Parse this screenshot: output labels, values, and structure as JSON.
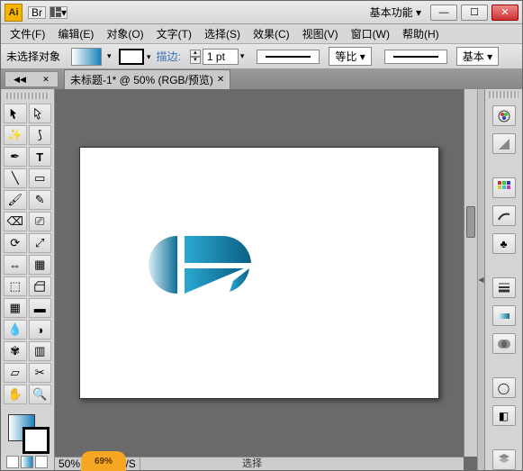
{
  "titlebar": {
    "app_abbrev": "Ai",
    "workspace_label": "基本功能 ▾"
  },
  "menu": {
    "file": "文件(F)",
    "edit": "编辑(E)",
    "object": "对象(O)",
    "type": "文字(T)",
    "select": "选择(S)",
    "effect": "效果(C)",
    "view": "视图(V)",
    "window": "窗口(W)",
    "help": "帮助(H)"
  },
  "controlbar": {
    "no_selection": "未选择对象",
    "stroke_label": "描边:",
    "stroke_value": "1 pt",
    "profile_label": "等比 ▾",
    "style_label": "基本 ▾"
  },
  "tab": {
    "title": "未标题-1* @ 50% (RGB/预览)"
  },
  "status": {
    "zoom": "50%",
    "net": "0.05K/S",
    "pointer_label": "选择",
    "hint": "69%"
  }
}
